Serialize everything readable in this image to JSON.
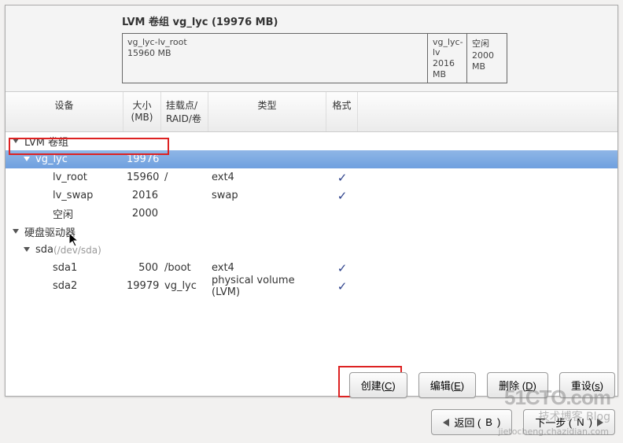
{
  "summary": {
    "title": "LVM 卷组 vg_lyc (19976 MB)",
    "cells": [
      {
        "name": "vg_lyc-lv_root",
        "size": "15960 MB"
      },
      {
        "name": "vg_lyc-lv",
        "size": "2016 MB"
      },
      {
        "name": "空闲",
        "size": "2000 MB"
      }
    ]
  },
  "columns": {
    "device": "设备",
    "size": "大小 (MB)",
    "mount": "挂载点/ RAID/卷",
    "type": "类型",
    "format": "格式"
  },
  "groups": {
    "lvm_label": "LVM 卷组",
    "hd_label": "硬盘驱动器"
  },
  "rows": {
    "vg": {
      "name": "vg_lyc",
      "size": "19976"
    },
    "lv_root": {
      "name": "lv_root",
      "size": "15960",
      "mount": "/",
      "type": "ext4",
      "fmt": "✓"
    },
    "lv_swap": {
      "name": "lv_swap",
      "size": "2016",
      "mount": "",
      "type": "swap",
      "fmt": "✓"
    },
    "free": {
      "name": "空闲",
      "size": "2000"
    },
    "sda": {
      "name": "sda",
      "dim": "(/dev/sda)"
    },
    "sda1": {
      "name": "sda1",
      "size": "500",
      "mount": "/boot",
      "type": "ext4",
      "fmt": "✓"
    },
    "sda2": {
      "name": "sda2",
      "size": "19979",
      "mount": "vg_lyc",
      "type": "physical volume (LVM)",
      "fmt": "✓"
    }
  },
  "buttons": {
    "create": {
      "label": "创建(",
      "mn": "C",
      "tail": ")"
    },
    "edit": {
      "label": "编辑(",
      "mn": "E",
      "tail": ")"
    },
    "delete": {
      "label": "删除 (",
      "mn": "D",
      "tail": ")"
    },
    "reset": {
      "label": "重设(",
      "mn": "s",
      "tail": ")"
    },
    "back": {
      "label": "返回 (",
      "mn": "B",
      "tail": ")"
    },
    "next": {
      "label": "下一步 (",
      "mn": "N",
      "tail": ")"
    }
  },
  "watermarks": {
    "w1": "51CTO.com",
    "w2": "技术博客 Blog",
    "w3": "jietocheng.chazidian.com"
  }
}
